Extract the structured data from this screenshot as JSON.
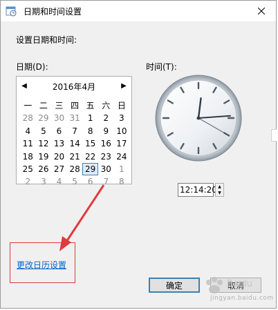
{
  "window": {
    "title": "日期和时间设置"
  },
  "heading": "设置日期和时间:",
  "date_label": "日期(D):",
  "time_label": "时间(T):",
  "calendar": {
    "month_title": "2016年4月",
    "weekdays": [
      "一",
      "二",
      "三",
      "四",
      "五",
      "六",
      "日"
    ],
    "weeks": [
      [
        "28",
        "29",
        "30",
        "31",
        "1",
        "2",
        "3"
      ],
      [
        "4",
        "5",
        "6",
        "7",
        "8",
        "9",
        "10"
      ],
      [
        "11",
        "12",
        "13",
        "14",
        "15",
        "16",
        "17"
      ],
      [
        "18",
        "19",
        "20",
        "21",
        "22",
        "23",
        "24"
      ],
      [
        "25",
        "26",
        "27",
        "28",
        "29",
        "30",
        "1"
      ],
      [
        "2",
        "3",
        "4",
        "5",
        "6",
        "7",
        "8"
      ]
    ],
    "selected_day": "29"
  },
  "clock": {
    "hour": 12,
    "minute": 14,
    "second": 20
  },
  "time_value": "12:14:20",
  "change_calendar_link": "更改日历设置",
  "buttons": {
    "ok": "确定",
    "cancel": "取消"
  },
  "watermark": {
    "text": "jingyan.baidu.com"
  },
  "colors": {
    "link": "#0066cc",
    "annotation": "#e03a3a",
    "selection": "#3c7fb1"
  }
}
